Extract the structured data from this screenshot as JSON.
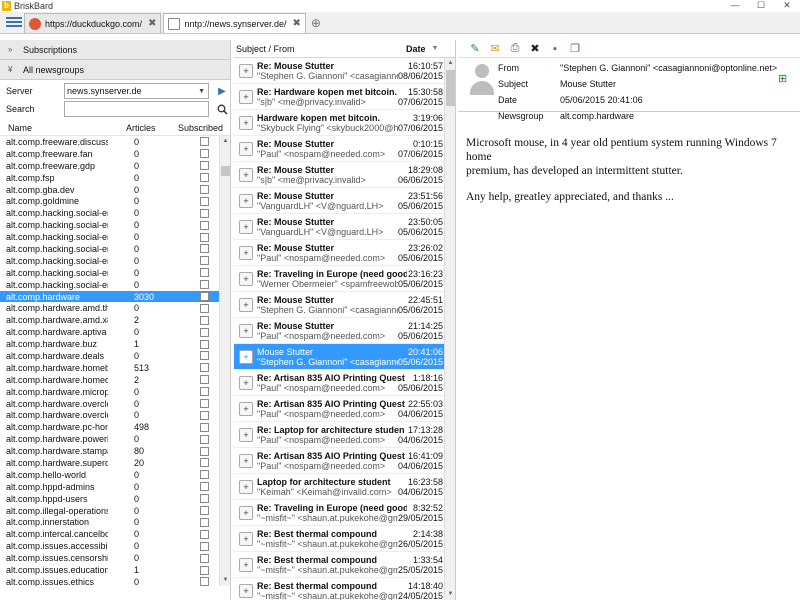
{
  "app": {
    "title": "BriskBard"
  },
  "window": {
    "minimize": "—",
    "maximize": "☐",
    "close": "✕"
  },
  "tabs": [
    {
      "label": "https://duckduckgo.com/",
      "close": "✖"
    },
    {
      "label": "nntp://news.synserver.de/",
      "close": "✖"
    }
  ],
  "tab_add": "⊕",
  "left": {
    "subscriptions": "Subscriptions",
    "all_newsgroups": "All newsgroups",
    "server_label": "Server",
    "server_value": "news.synserver.de",
    "search_label": "Search",
    "search_placeholder": "",
    "columns": {
      "name": "Name",
      "articles": "Articles",
      "subscribed": "Subscribed"
    },
    "groups": [
      {
        "name": "alt.comp.freeware.discussio",
        "articles": "0"
      },
      {
        "name": "alt.comp.freeware.fan",
        "articles": "0"
      },
      {
        "name": "alt.comp.freeware.gdp",
        "articles": "0"
      },
      {
        "name": "alt.comp.fsp",
        "articles": "0"
      },
      {
        "name": "alt.comp.gba.dev",
        "articles": "0"
      },
      {
        "name": "alt.comp.goldmine",
        "articles": "0"
      },
      {
        "name": "alt.comp.hacking.social-engi",
        "articles": "0"
      },
      {
        "name": "alt.comp.hacking.social-engi",
        "articles": "0"
      },
      {
        "name": "alt.comp.hacking.social-engi",
        "articles": "0"
      },
      {
        "name": "alt.comp.hacking.social-engi",
        "articles": "0"
      },
      {
        "name": "alt.comp.hacking.social-engi",
        "articles": "0"
      },
      {
        "name": "alt.comp.hacking.social-engi",
        "articles": "0"
      },
      {
        "name": "alt.comp.hacking.social-engi",
        "articles": "0"
      },
      {
        "name": "alt.comp.hardware",
        "articles": "3030"
      },
      {
        "name": "alt.comp.hardware.amd.thu",
        "articles": "0"
      },
      {
        "name": "alt.comp.hardware.amd.x86",
        "articles": "2"
      },
      {
        "name": "alt.comp.hardware.aptiva",
        "articles": "0"
      },
      {
        "name": "alt.comp.hardware.buz",
        "articles": "1"
      },
      {
        "name": "alt.comp.hardware.deals",
        "articles": "0"
      },
      {
        "name": "alt.comp.hardware.homebui",
        "articles": "513"
      },
      {
        "name": "alt.comp.hardware.homedes",
        "articles": "2"
      },
      {
        "name": "alt.comp.hardware.micropro",
        "articles": "0"
      },
      {
        "name": "alt.comp.hardware.overcloc",
        "articles": "0"
      },
      {
        "name": "alt.comp.hardware.overcloc",
        "articles": "0"
      },
      {
        "name": "alt.comp.hardware.pc-home",
        "articles": "498"
      },
      {
        "name": "alt.comp.hardware.powerlea",
        "articles": "0"
      },
      {
        "name": "alt.comp.hardware.stampan",
        "articles": "80"
      },
      {
        "name": "alt.comp.hardware.superdis",
        "articles": "20"
      },
      {
        "name": "alt.comp.hello-world",
        "articles": "0"
      },
      {
        "name": "alt.comp.hppd-admins",
        "articles": "0"
      },
      {
        "name": "alt.comp.hppd-users",
        "articles": "0"
      },
      {
        "name": "alt.comp.illegal-operations.p",
        "articles": "0"
      },
      {
        "name": "alt.comp.innerstation",
        "articles": "0"
      },
      {
        "name": "alt.comp.intercal.cancelbots",
        "articles": "0"
      },
      {
        "name": "alt.comp.issues.accessibility",
        "articles": "0"
      },
      {
        "name": "alt.comp.issues.censorship",
        "articles": "0"
      },
      {
        "name": "alt.comp.issues.education",
        "articles": "1"
      },
      {
        "name": "alt.comp.issues.ethics",
        "articles": "0"
      }
    ],
    "selected_group_index": 13
  },
  "middle": {
    "col_subject": "Subject / From",
    "col_date": "Date",
    "messages": [
      {
        "subject": "Re: Mouse Stutter",
        "from": "\"Stephen G. Giannoni\" <casagiannoni@o",
        "time": "16:10:57",
        "date": "08/06/2015"
      },
      {
        "subject": "Re: Hardware kopen met bitcoin.",
        "from": "\"s|b\" <me@privacy.invalid>",
        "time": "15:30:58",
        "date": "07/06/2015"
      },
      {
        "subject": "Hardware kopen met bitcoin.",
        "from": "\"Skybuck Flying\" <skybuck2000@hotmai",
        "time": "3:19:06",
        "date": "07/06/2015"
      },
      {
        "subject": "Re: Mouse Stutter",
        "from": "\"Paul\" <nospam@needed.com>",
        "time": "0:10:15",
        "date": "07/06/2015"
      },
      {
        "subject": "Re: Mouse Stutter",
        "from": "\"s|b\" <me@privacy.invalid>",
        "time": "18:29:08",
        "date": "06/06/2015"
      },
      {
        "subject": "Re: Mouse Stutter",
        "from": "\"VanguardLH\" <V@nguard.LH>",
        "time": "23:51:56",
        "date": "05/06/2015"
      },
      {
        "subject": "Re: Mouse Stutter",
        "from": "\"VanguardLH\" <V@nguard.LH>",
        "time": "23:50:05",
        "date": "05/06/2015"
      },
      {
        "subject": "Re: Mouse Stutter",
        "from": "\"Paul\" <nospam@needed.com>",
        "time": "23:26:02",
        "date": "05/06/2015"
      },
      {
        "subject": "Re: Traveling in Europe (need good",
        "from": "\"Werner Obermeier\" <spamfreewob@an",
        "time": "23:16:23",
        "date": "05/06/2015"
      },
      {
        "subject": "Re: Mouse Stutter",
        "from": "\"Stephen G. Giannoni\" <casagiannoni@o",
        "time": "22:45:51",
        "date": "05/06/2015"
      },
      {
        "subject": "Re: Mouse Stutter",
        "from": "\"Paul\" <nospam@needed.com>",
        "time": "21:14:25",
        "date": "05/06/2015"
      },
      {
        "subject": "Mouse Stutter",
        "from": "\"Stephen G. Giannoni\" <casagiannoni@o",
        "time": "20:41:06",
        "date": "05/06/2015"
      },
      {
        "subject": "Re: Artisan 835 AIO Printing Quest",
        "from": "\"Paul\" <nospam@needed.com>",
        "time": "1:18:16",
        "date": "05/06/2015"
      },
      {
        "subject": "Re: Artisan 835 AIO Printing Quest",
        "from": "\"Paul\" <nospam@needed.com>",
        "time": "22:55:03",
        "date": "04/06/2015"
      },
      {
        "subject": "Re: Laptop for architecture studen",
        "from": "\"Paul\" <nospam@needed.com>",
        "time": "17:13:28",
        "date": "04/06/2015"
      },
      {
        "subject": "Re: Artisan 835 AIO Printing Quest",
        "from": "\"Paul\" <nospam@needed.com>",
        "time": "16:41:09",
        "date": "04/06/2015"
      },
      {
        "subject": "Laptop for architecture student",
        "from": "\"Keimah\" <Keimah@invalid.com>",
        "time": "16:23:58",
        "date": "04/06/2015"
      },
      {
        "subject": "Re: Traveling in Europe (need good",
        "from": "\"~misfit~\" <shaun.at.pukekohe@gmai",
        "time": "8:32:52",
        "date": "29/05/2015"
      },
      {
        "subject": "Re: Best thermal compound",
        "from": "\"~misfit~\" <shaun.at.pukekohe@gmai",
        "time": "2:14:38",
        "date": "26/05/2015"
      },
      {
        "subject": "Re: Best thermal compound",
        "from": "\"~misfit~\" <shaun.at.pukekohe@gmai",
        "time": "1:33:54",
        "date": "25/05/2015"
      },
      {
        "subject": "Re: Best thermal compound",
        "from": "\"~misfit~\" <shaun.at.pukekohe@gmai",
        "time": "14:18:40",
        "date": "24/05/2015"
      }
    ],
    "selected_message_index": 11
  },
  "right": {
    "headers": {
      "from_label": "From",
      "from_value": "\"Stephen G. Giannoni\" <casagiannoni@optonline.net>",
      "subject_label": "Subject",
      "subject_value": "Mouse Stutter",
      "date_label": "Date",
      "date_value": "05/06/2015 20:41:06",
      "newsgroup_label": "Newsgroup",
      "newsgroup_value": "alt.comp.hardware"
    },
    "body": {
      "line1": "Microsoft mouse, in 4 year old pentium system running Windows 7 home",
      "line2": "premium, has developed an intermittent stutter.",
      "line3": "Any help, greatley appreciated, and thanks  ..."
    }
  },
  "colors": {
    "accent": "#3399ff",
    "header_bg": "#e9e9e9",
    "icon_blue": "#3a6fb0"
  }
}
